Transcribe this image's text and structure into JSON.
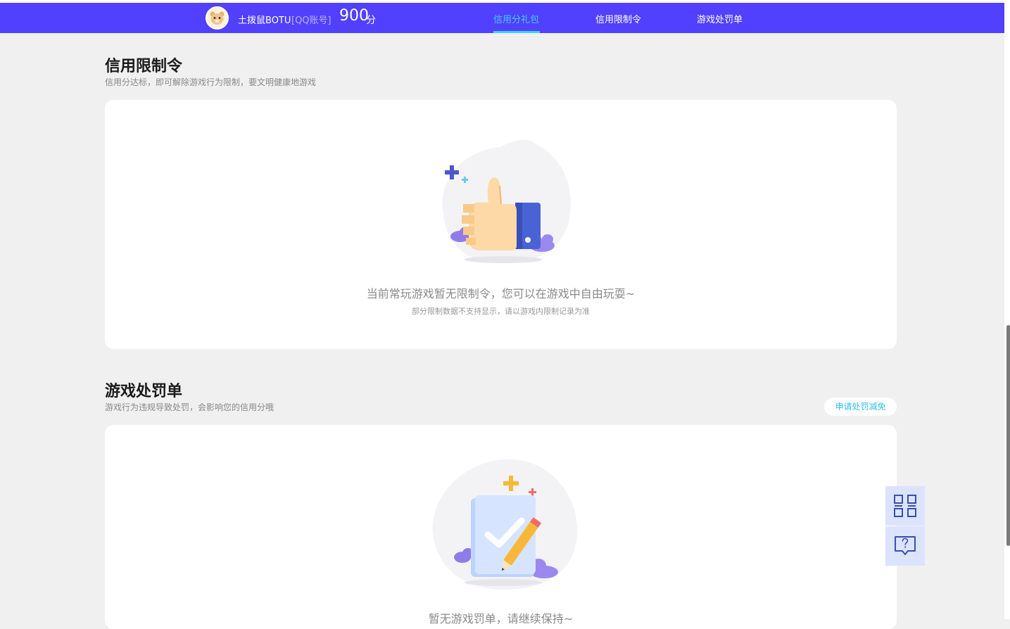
{
  "header": {
    "username": "土拨鼠BOTU",
    "account_type": "[QQ账号]",
    "score": "900",
    "score_unit": "分",
    "tabs": [
      {
        "label": "信用分礼包",
        "active": true
      },
      {
        "label": "信用限制令",
        "active": false
      },
      {
        "label": "游戏处罚单",
        "active": false
      }
    ]
  },
  "restriction": {
    "title": "信用限制令",
    "subtitle": "信用分达标，即可解除游戏行为限制，要文明健康地游戏",
    "empty_main": "当前常玩游戏暂无限制令，您可以在游戏中自由玩耍~",
    "empty_sub": "部分限制数据不支持显示，请以游戏内限制记录为准"
  },
  "penalty": {
    "title": "游戏处罚单",
    "subtitle": "游戏行为违规导致处罚，会影响您的信用分哦",
    "appeal_label": "申请处罚减免",
    "empty_main": "暂无游戏罚单，请继续保持~"
  },
  "floating": {
    "qr_icon": "qr-code-icon",
    "help_icon": "help-chat-icon"
  },
  "colors": {
    "nav_bg": "#5240ff",
    "active_tab": "#3fd0ff",
    "page_bg": "#f0f0f0",
    "float_bg": "#dbe3ff",
    "float_icon": "#3a4fb0"
  }
}
